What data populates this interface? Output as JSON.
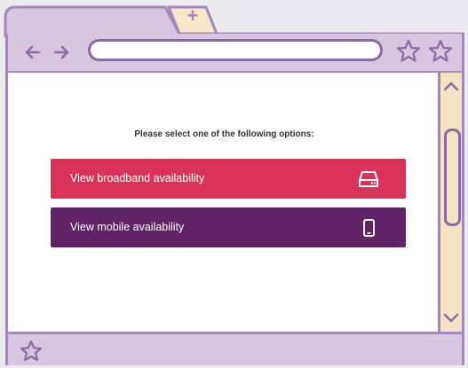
{
  "browser": {
    "new_tab_glyph": "+",
    "address_value": "",
    "nav": {
      "back_icon": "arrow-left-icon",
      "forward_icon": "arrow-right-icon"
    },
    "star_icon": "star-icon",
    "colors": {
      "frame": "#a488bd",
      "chrome": "#d7c6e0",
      "accent": "#8a6aa8",
      "scroll_track": "#f7e3c4",
      "new_tab": "#f9e7c8"
    }
  },
  "page": {
    "prompt": "Please select one of the following options:",
    "options": [
      {
        "label": "View broadband availability",
        "icon": "router-icon",
        "color": "#d9335c"
      },
      {
        "label": "View mobile availability",
        "icon": "mobile-phone-icon",
        "color": "#5f2366"
      }
    ]
  }
}
